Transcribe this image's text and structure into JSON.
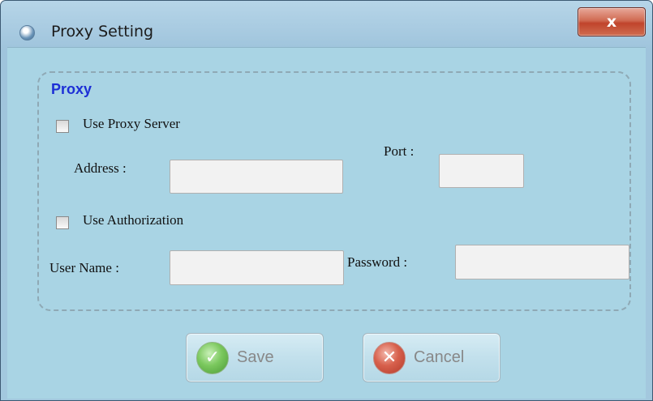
{
  "window": {
    "title": "Proxy Setting",
    "close_glyph": "x",
    "app_icon": "globe-icon"
  },
  "proxy": {
    "group_title": "Proxy",
    "use_proxy_label": "Use Proxy Server",
    "use_proxy_checked": false,
    "address_label": "Address :",
    "address_value": "",
    "port_label": "Port :",
    "port_value": "",
    "use_auth_label": "Use Authorization",
    "use_auth_checked": false,
    "username_label": "User Name :",
    "username_value": "",
    "password_label": "Password :",
    "password_value": ""
  },
  "buttons": {
    "save_label": "Save",
    "save_icon": "checkmark-icon",
    "cancel_label": "Cancel",
    "cancel_icon": "cross-icon"
  }
}
